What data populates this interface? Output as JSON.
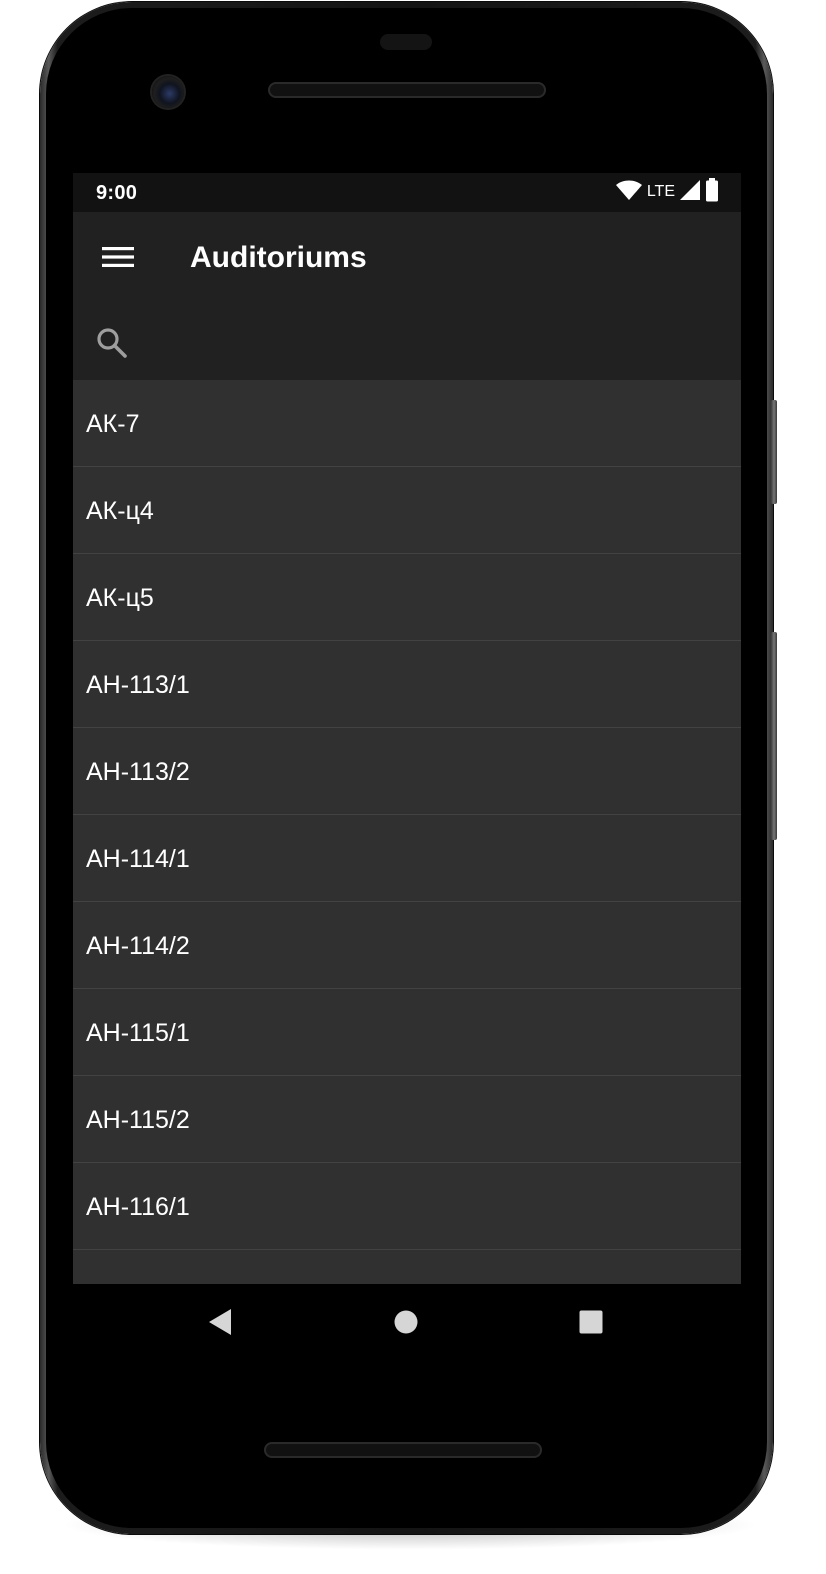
{
  "status_bar": {
    "time": "9:00",
    "network": "LTE",
    "icons": [
      "wifi-icon",
      "signal-icon",
      "battery-icon"
    ]
  },
  "app_bar": {
    "title": "Auditoriums",
    "menu_icon": "hamburger-menu-icon"
  },
  "search": {
    "icon": "search-icon",
    "value": "",
    "placeholder": ""
  },
  "list": {
    "items": [
      {
        "label": "АК-7"
      },
      {
        "label": "АК-ц4"
      },
      {
        "label": "АК-ц5"
      },
      {
        "label": "АН-113/1"
      },
      {
        "label": "АН-113/2"
      },
      {
        "label": "АН-114/1"
      },
      {
        "label": "АН-114/2"
      },
      {
        "label": "АН-115/1"
      },
      {
        "label": "АН-115/2"
      },
      {
        "label": "АН-116/1"
      }
    ]
  },
  "nav_bar": {
    "icons": [
      "back-icon",
      "home-icon",
      "recents-icon"
    ]
  },
  "colors": {
    "status_bar_bg": "#121212",
    "app_bar_bg": "#212121",
    "list_bg": "#303030",
    "divider": "#424242",
    "text": "#ffffff",
    "icon_grey": "#9e9e9e"
  }
}
